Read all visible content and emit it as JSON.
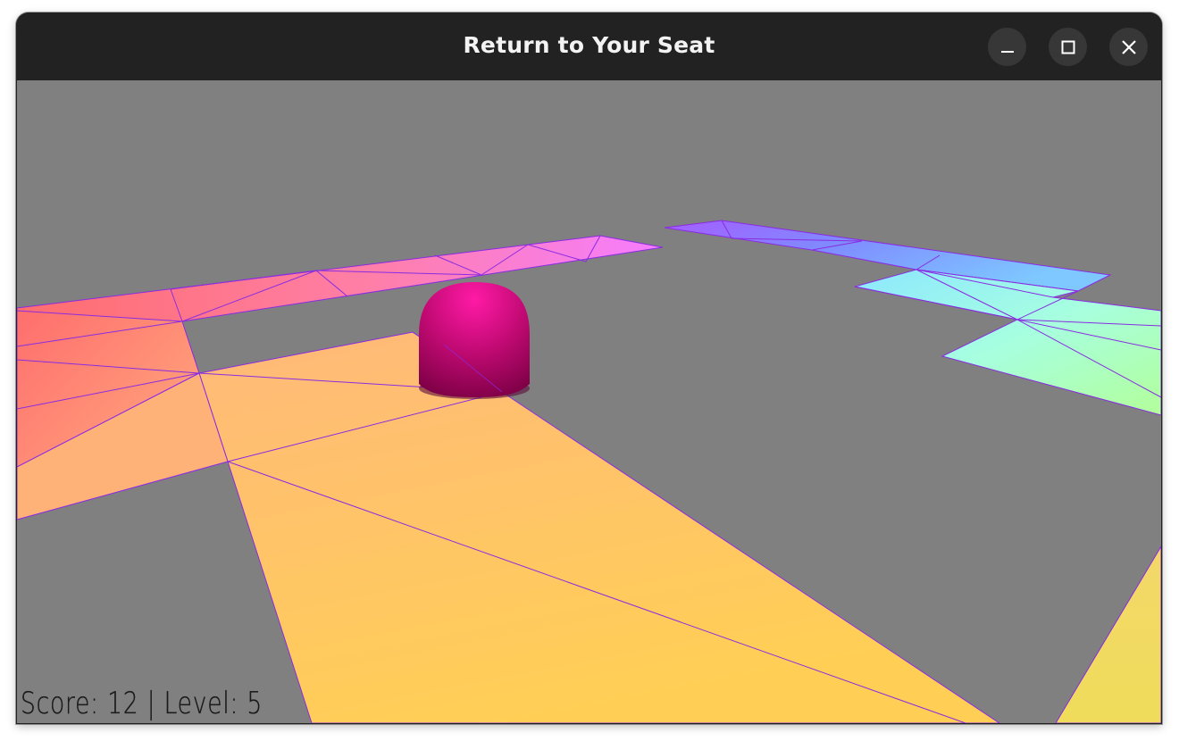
{
  "window": {
    "title": "Return to Your Seat",
    "minimize_icon": "minimize-icon",
    "maximize_icon": "maximize-icon",
    "close_icon": "close-icon"
  },
  "hud": {
    "score_label": "Score:",
    "score": "12",
    "separator": "|",
    "level_label": "Level:",
    "level": "5"
  },
  "colors": {
    "background": "#808080",
    "titlebar": "#222222",
    "tile_edges": "#8a2be2",
    "player": "#e0107f"
  }
}
